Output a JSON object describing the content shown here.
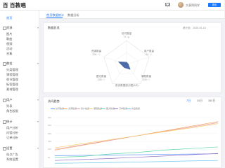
{
  "app": {
    "logo": "百 百教唱"
  },
  "header": {
    "username": "大表哥同学",
    "logout_label": "退出"
  },
  "sidebar": {
    "items": [
      {
        "label": "首页",
        "group": false,
        "active": true
      },
      {
        "label": "资源",
        "group": true
      },
      {
        "label": "图片",
        "group": false
      },
      {
        "label": "歌曲",
        "group": false
      },
      {
        "label": "视频",
        "group": false
      },
      {
        "label": "活动",
        "group": false
      },
      {
        "label": "合集",
        "group": false
      },
      {
        "label": "教程",
        "group": true
      },
      {
        "label": "分类管理",
        "group": false
      },
      {
        "label": "课程管理",
        "group": false
      },
      {
        "label": "章节管理",
        "group": false
      },
      {
        "label": "标签管理",
        "group": false
      },
      {
        "label": "素材管理",
        "group": false
      },
      {
        "label": "用户",
        "group": true
      },
      {
        "label": "列表",
        "group": false
      },
      {
        "label": "角色权限",
        "group": false
      },
      {
        "label": "统计",
        "group": true
      },
      {
        "label": "用户分析",
        "group": false
      },
      {
        "label": "内容分析",
        "group": false
      },
      {
        "label": "订单分析",
        "group": false
      },
      {
        "label": "设置",
        "group": true
      },
      {
        "label": "站点广告",
        "group": false
      },
      {
        "label": "系统设置",
        "group": false
      }
    ]
  },
  "tabs": [
    {
      "label": "首页数据统计",
      "active": true
    },
    {
      "label": "数据分析",
      "active": false
    }
  ],
  "overview": {
    "title": "数据总览",
    "date": "统计至：2020-01-16",
    "radar": {
      "axes": [
        {
          "label": "访问数量",
          "value": "77",
          "unit": "/条"
        },
        {
          "label": "用户数量",
          "value": "61",
          "unit": "/人"
        },
        {
          "label": "课程数量",
          "value": "209",
          "unit": "/个"
        },
        {
          "label": "图文数量",
          "value": "135",
          "unit": "/个"
        },
        {
          "label": "资源数量",
          "value": "291",
          "unit": "/个"
        }
      ],
      "center_label": "首页数据统计图(1/3)"
    }
  },
  "trend": {
    "title": "访问趋势",
    "ranges": [
      {
        "label": "7日",
        "active": true
      },
      {
        "label": "30日",
        "active": false
      },
      {
        "label": "365日",
        "active": false
      }
    ]
  },
  "chart_data": {
    "type": "line",
    "x": [
      1,
      2,
      3,
      4,
      5,
      6,
      7
    ],
    "series": [
      {
        "name": "访问数量",
        "color": "#5b8ff9",
        "values": [
          60,
          62,
          64,
          66,
          68,
          70,
          72
        ]
      },
      {
        "name": "资源数量",
        "color": "#f6a35c",
        "values": [
          95,
          125,
          155,
          185,
          215,
          245,
          275
        ]
      },
      {
        "name": "用户数量",
        "color": "#e8a0b4",
        "values": [
          100,
          128,
          156,
          184,
          212,
          240,
          268
        ]
      },
      {
        "name": "课程数量",
        "color": "#f7d070",
        "values": [
          110,
          135,
          160,
          185,
          210,
          235,
          262
        ]
      },
      {
        "name": "图文数量",
        "color": "#5ad8a6",
        "values": [
          50,
          55,
          70,
          80,
          95,
          105,
          115
        ]
      },
      {
        "name": "订单数量",
        "color": "#9270ca",
        "values": [
          30,
          36,
          42,
          50,
          58,
          66,
          74
        ]
      },
      {
        "name": "商品数量",
        "color": "#6dc8ec",
        "values": [
          12,
          14,
          17,
          20,
          23,
          27,
          30
        ]
      }
    ],
    "ylim": [
      0,
      300
    ],
    "yticks": [
      "300",
      "250",
      "200",
      "150",
      "100",
      "50"
    ],
    "grid": true
  }
}
